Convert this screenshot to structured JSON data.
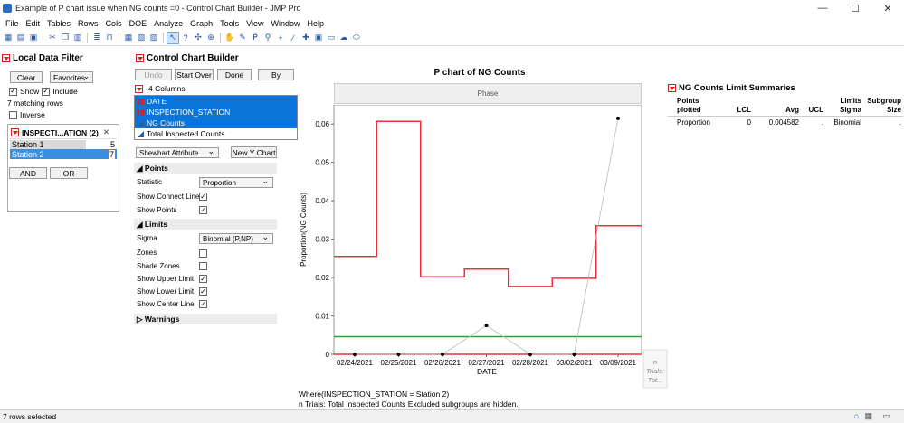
{
  "window": {
    "title": "Example of P chart issue when NG counts =0 - Control Chart Builder - JMP Pro",
    "min": "—",
    "max": "☐",
    "close": "✕"
  },
  "menu": [
    "File",
    "Edit",
    "Tables",
    "Rows",
    "Cols",
    "DOE",
    "Analyze",
    "Graph",
    "Tools",
    "View",
    "Window",
    "Help"
  ],
  "toolbar_icons": [
    "new-table-icon",
    "open-icon",
    "save-icon",
    "cut-icon",
    "copy-icon",
    "paste-icon",
    "script-icon",
    "lock-icon",
    "data-table-icon",
    "report-icon",
    "journal-icon",
    "arrow-icon",
    "help-icon",
    "crosshair-icon",
    "scroller-icon",
    "hand-icon",
    "brush-icon",
    "lasso-icon",
    "zoom-icon",
    "plus-icon",
    "line-icon",
    "annotate-icon",
    "text-icon",
    "simple-shape-icon",
    "polygon-icon",
    "oval-icon"
  ],
  "filter": {
    "title": "Local Data Filter",
    "clear": "Clear",
    "favorites": "Favorites",
    "show": "Show",
    "include": "Include",
    "matching": "7 matching rows",
    "inverse": "Inverse",
    "group_title": "INSPECTI...ATION (2)",
    "items": [
      {
        "label": "Station 1",
        "count": "5",
        "fill": 0.71
      },
      {
        "label": "Station 2",
        "count": "7",
        "fill": 1.0
      }
    ],
    "and": "AND",
    "or": "OR"
  },
  "builder": {
    "title": "Control Chart Builder",
    "undo": "Undo",
    "start_over": "Start Over",
    "done": "Done",
    "by": "By",
    "columns_header": "4 Columns",
    "columns": [
      "DATE",
      "INSPECTION_STATION",
      "NG Counts",
      "Total Inspected Counts"
    ],
    "chart_type": "Shewhart Attribute",
    "new_y": "New Y Chart",
    "points_header": "Points",
    "statistic_label": "Statistic",
    "statistic_value": "Proportion",
    "show_connect": "Show Connect Line",
    "show_points": "Show Points",
    "limits_header": "Limits",
    "sigma_label": "Sigma",
    "sigma_value": "Binomial (P,NP)",
    "zones": "Zones",
    "shade_zones": "Shade Zones",
    "upper": "Show Upper Limit",
    "lower": "Show Lower Limit",
    "center": "Show Center Line",
    "warnings": "Warnings"
  },
  "chart": {
    "title": "P chart of NG Counts",
    "phase": "Phase",
    "ylabel": "Proportion(NG Counts)",
    "xlabel": "DATE",
    "yticks": [
      "0",
      "0.01",
      "0.02",
      "0.03",
      "0.04",
      "0.05",
      "0.06"
    ],
    "xticks": [
      "02/24/2021",
      "02/25/2021",
      "02/26/2021",
      "02/27/2021",
      "02/28/2021",
      "03/02/2021",
      "03/09/2021"
    ],
    "right_label": [
      "n",
      "Trials:",
      "Tot..."
    ]
  },
  "chart_data": {
    "type": "line",
    "x": [
      "02/24/2021",
      "02/25/2021",
      "02/26/2021",
      "02/27/2021",
      "02/28/2021",
      "03/02/2021",
      "03/09/2021"
    ],
    "series": [
      {
        "name": "Proportion",
        "values": [
          0,
          0,
          0,
          0.0075,
          0,
          0,
          0.0615
        ]
      },
      {
        "name": "UCL",
        "values": [
          0.0255,
          0.0607,
          0.0202,
          0.0222,
          0.0177,
          0.0198,
          0.0335
        ]
      },
      {
        "name": "Avg",
        "values": [
          0.004582,
          0.004582,
          0.004582,
          0.004582,
          0.004582,
          0.004582,
          0.004582
        ]
      },
      {
        "name": "LCL",
        "values": [
          0,
          0,
          0,
          0,
          0,
          0,
          0
        ]
      }
    ],
    "ylim": [
      0,
      0.065
    ],
    "xlabel": "DATE",
    "ylabel": "Proportion(NG Counts)",
    "title": "P chart of NG Counts",
    "colors": {
      "points": "#000000",
      "ucl": "#e8303a",
      "avg": "#2ca02c",
      "connect": "#bbbbbb"
    }
  },
  "footnotes": [
    "Where(INSPECTION_STATION = Station 2)",
    "n Trials: Total Inspected Counts Excluded subgroups are hidden."
  ],
  "summary": {
    "title": "NG Counts Limit Summaries",
    "headers": [
      [
        "Points",
        "plotted"
      ],
      [
        "",
        "LCL"
      ],
      [
        "",
        "Avg"
      ],
      [
        "",
        "UCL"
      ],
      [
        "Limits",
        "Sigma"
      ],
      [
        "Subgroup",
        "Size"
      ]
    ],
    "row": [
      "Proportion",
      "0",
      "0.004582",
      ".",
      "Binomial",
      "."
    ]
  },
  "status": {
    "text": "7 rows selected"
  }
}
